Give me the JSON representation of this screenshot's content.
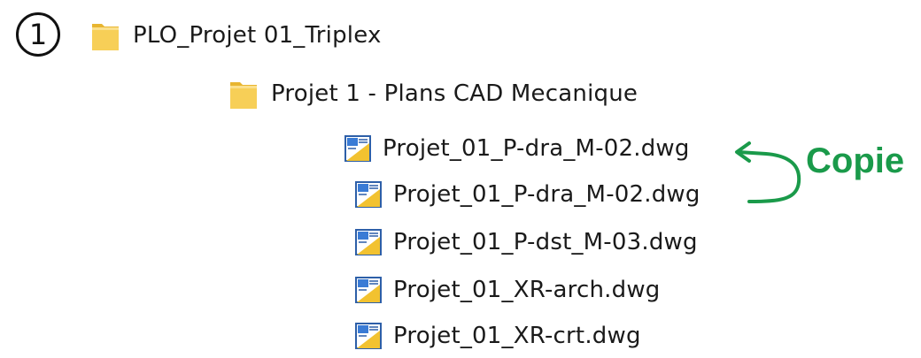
{
  "step_marker": "1",
  "tree": {
    "root_folder": {
      "label": "PLO_Projet 01_Triplex",
      "icon": "folder-icon"
    },
    "sub_folder": {
      "label": "Projet 1 - Plans CAD Mecanique",
      "icon": "folder-icon"
    },
    "files": [
      {
        "label": "Projet_01_P-dra_M-02.dwg",
        "icon": "dwg-file-icon"
      },
      {
        "label": "Projet_01_P-dra_M-02.dwg",
        "icon": "dwg-file-icon"
      },
      {
        "label": "Projet_01_P-dst_M-03.dwg",
        "icon": "dwg-file-icon"
      },
      {
        "label": "Projet_01_XR-arch.dwg",
        "icon": "dwg-file-icon"
      },
      {
        "label": "Projet_01_XR-crt.dwg",
        "icon": "dwg-file-icon"
      }
    ]
  },
  "annotation": {
    "label": "Copie",
    "color": "#1a9a4a"
  },
  "colors": {
    "folder": "#f5c542",
    "dwg_blue": "#3a7bd5",
    "dwg_yellow": "#f2c230"
  }
}
